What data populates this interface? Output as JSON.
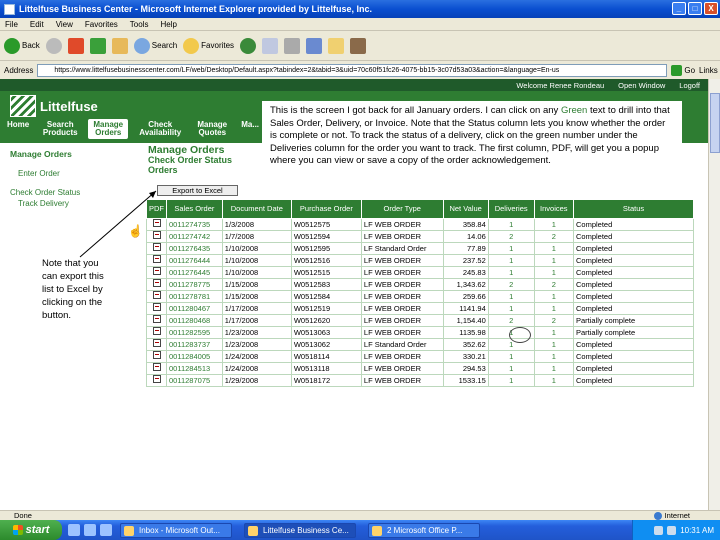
{
  "window": {
    "title": "Littelfuse Business Center - Microsoft Internet Explorer provided by Littelfuse, Inc.",
    "controls": [
      "_",
      "□",
      "X"
    ]
  },
  "menu": [
    "File",
    "Edit",
    "View",
    "Favorites",
    "Tools",
    "Help"
  ],
  "toolbar": {
    "back": "Back",
    "search": "Search",
    "favorites": "Favorites"
  },
  "address": {
    "label": "Address",
    "url": "https://www.littelfusebusinesscenter.com/LF/web/Desktop/Default.aspx?tabindex=2&tabid=3&uid=70c60f51fc26-4075-bb15-3c07d53a03&action=&language=En-us",
    "go": "Go",
    "links": "Links"
  },
  "site": {
    "topnav": [
      "Welcome Renee Rondeau",
      "Open Window",
      "Logoff"
    ],
    "logo_text": "Littelfuse",
    "nav": [
      "Home",
      "Search Products",
      "Manage Orders",
      "Check Availability",
      "Manage Quotes",
      "Ma..."
    ],
    "leftnav": {
      "heading": "Manage Orders",
      "items": [
        "Enter Order",
        "Check Order Status",
        "Track Delivery"
      ]
    },
    "content": {
      "heading": "Manage Orders",
      "subheading": "Check Order Status",
      "subtitle": "Orders",
      "export_button": "Export to Excel"
    },
    "table": {
      "headers": [
        "PDF",
        "Sales Order",
        "Document Date",
        "Purchase Order",
        "Order Type",
        "Net Value",
        "Deliveries",
        "Invoices",
        "Status"
      ],
      "rows": [
        [
          "",
          "0011274735",
          "1/3/2008",
          "W0512575",
          "LF WEB ORDER",
          "358.84",
          "1",
          "1",
          "Completed"
        ],
        [
          "",
          "0011274742",
          "1/7/2008",
          "W0512594",
          "LF WEB ORDER",
          "14.06",
          "2",
          "2",
          "Completed"
        ],
        [
          "",
          "0011276435",
          "1/10/2008",
          "W0512595",
          "LF Standard Order",
          "77.89",
          "1",
          "1",
          "Completed"
        ],
        [
          "",
          "0011276444",
          "1/10/2008",
          "W0512516",
          "LF WEB ORDER",
          "237.52",
          "1",
          "1",
          "Completed"
        ],
        [
          "",
          "0011276445",
          "1/10/2008",
          "W0512515",
          "LF WEB ORDER",
          "245.83",
          "1",
          "1",
          "Completed"
        ],
        [
          "",
          "0011278775",
          "1/15/2008",
          "W0512583",
          "LF WEB ORDER",
          "1,343.62",
          "2",
          "2",
          "Completed"
        ],
        [
          "",
          "0011278781",
          "1/15/2008",
          "W0512584",
          "LF WEB ORDER",
          "259.66",
          "1",
          "1",
          "Completed"
        ],
        [
          "",
          "0011280467",
          "1/17/2008",
          "W0512519",
          "LF WEB ORDER",
          "1141.94",
          "1",
          "1",
          "Completed"
        ],
        [
          "",
          "0011280468",
          "1/17/2008",
          "W0512620",
          "LF WEB ORDER",
          "1,154.40",
          "2",
          "2",
          "Partially complete"
        ],
        [
          "",
          "0011282595",
          "1/23/2008",
          "W0513063",
          "LF WEB ORDER",
          "1135.98",
          "1",
          "1",
          "Partially complete"
        ],
        [
          "",
          "0011283737",
          "1/23/2008",
          "W0513062",
          "LF Standard Order",
          "352.62",
          "1",
          "1",
          "Completed"
        ],
        [
          "",
          "0011284005",
          "1/24/2008",
          "W0518114",
          "LF WEB ORDER",
          "330.21",
          "1",
          "1",
          "Completed"
        ],
        [
          "",
          "0011284513",
          "1/24/2008",
          "W0513118",
          "LF WEB ORDER",
          "294.53",
          "1",
          "1",
          "Completed"
        ],
        [
          "",
          "0011287075",
          "1/29/2008",
          "W0518172",
          "LF WEB ORDER",
          "1533.15",
          "1",
          "1",
          "Completed"
        ]
      ]
    }
  },
  "callout": {
    "text_before": "This is the screen I got back for all January orders.  I can click on any ",
    "green_word": "Green",
    "text_after": " text to drill into that Sales Order, Delivery, or Invoice.  Note that the Status column lets you know whether the order is complete or not.  To track the status of a delivery, click on the green number under the Deliveries column for the order you want to track.  The first column, PDF, will get you a popup where you can view or save a copy of the order acknowledgement."
  },
  "note": "Note that you can export this list to Excel by clicking on the button.",
  "status": {
    "left": "Done",
    "zone": "Internet"
  },
  "taskbar": {
    "start": "start",
    "tasks": [
      "Inbox - Microsoft Out...",
      "Littelfuse Business Ce...",
      "2 Microsoft Office P..."
    ],
    "clock": "10:31 AM"
  },
  "colors": {
    "brand_green": "#2e7d32",
    "xp_blue": "#245edb"
  }
}
